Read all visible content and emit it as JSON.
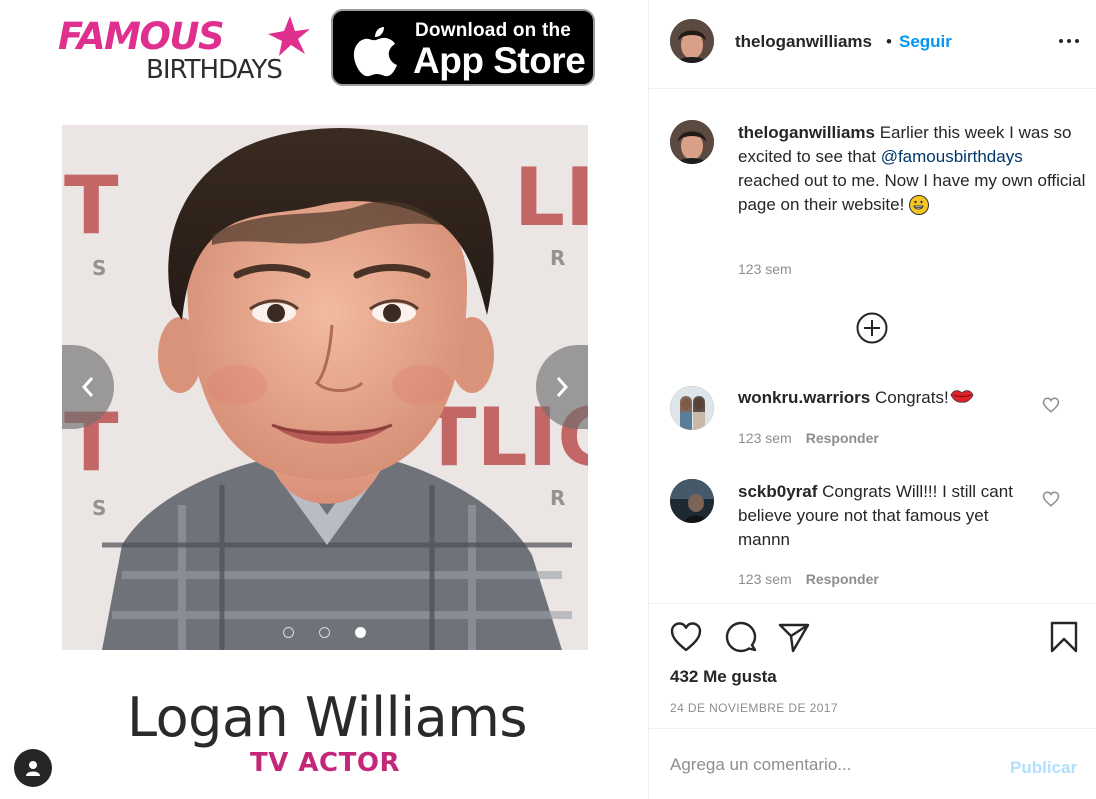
{
  "media": {
    "brand_famous": "FAMOUS",
    "brand_birthdays": "BIRTHDAYS",
    "appstore_small": "Download on the",
    "appstore_big": "App Store",
    "person_name": "Logan Williams",
    "person_role": "TV ACTOR",
    "carousel_total": 3,
    "carousel_active": 3,
    "background_sign_text": [
      "T",
      "S",
      "T",
      "S",
      "LIG",
      "R",
      "TLIG",
      "R"
    ]
  },
  "header": {
    "username": "theloganwilliams",
    "separator": "•",
    "follow_label": "Seguir"
  },
  "caption": {
    "username": "theloganwilliams",
    "text_before": " Earlier this week I was so excited to see that ",
    "mention": "@famousbirthdays",
    "text_after": " reached out to me. Now I have my own official page on their website! ",
    "time": "123 sem"
  },
  "comments": [
    {
      "username": "wonkru.warriors",
      "text": " Congrats!",
      "time": "123 sem",
      "reply_label": "Responder"
    },
    {
      "username": "sckb0yraf",
      "text": " Congrats Will!!! I still cant believe youre not that famous yet mannn",
      "time": "123 sem",
      "reply_label": "Responder"
    }
  ],
  "actions": {
    "likes": "432 Me gusta",
    "date": "24 DE NOVIEMBRE DE 2017"
  },
  "add_comment": {
    "placeholder": "Agrega un comentario...",
    "publish_label": "Publicar"
  },
  "colors": {
    "brand_pink": "#e0308f",
    "role_pink": "#c4267a",
    "follow_blue": "#0095f6",
    "mention_blue": "#00376b",
    "publish_disabled": "#b2dffc",
    "meta_gray": "#8e8e8e"
  },
  "icons": [
    "fb-star-icon",
    "apple-icon",
    "chevron-left-icon",
    "chevron-right-icon",
    "user-icon",
    "more-icon",
    "plus-circle-icon",
    "heart-icon",
    "comment-icon",
    "share-icon",
    "bookmark-icon",
    "grin-emoji-icon",
    "lips-emoji-icon"
  ]
}
